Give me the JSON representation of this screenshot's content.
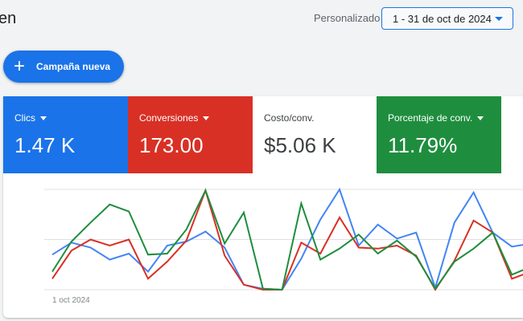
{
  "header": {
    "title": "en",
    "custom_label": "Personalizado",
    "date_range": "1 - 31 de oct de 2024"
  },
  "new_campaign": {
    "icon": "plus-icon",
    "label": "Campaña nueva"
  },
  "metrics": [
    {
      "label": "Clics",
      "value": "1.47 K",
      "color": "#1a73e8",
      "dropdown": true
    },
    {
      "label": "Conversiones",
      "value": "173.00",
      "color": "#d93025",
      "dropdown": true
    },
    {
      "label": "Costo/conv.",
      "value": "$5.06 K",
      "color": "#ffffff",
      "dropdown": false
    },
    {
      "label": "Porcentaje de conv.",
      "value": "11.79%",
      "color": "#1e8e3e",
      "dropdown": true
    }
  ],
  "chart_data": {
    "type": "line",
    "x_start_label": "1 oct 2024",
    "ylim": [
      0,
      100
    ],
    "grid": true,
    "series": [
      {
        "name": "Clics",
        "color": "#4285f4",
        "values": [
          35,
          47,
          42,
          30,
          36,
          18,
          44,
          48,
          58,
          42,
          5,
          1,
          0,
          31,
          70,
          100,
          44,
          65,
          51,
          57,
          2,
          67,
          97,
          57,
          43,
          46
        ]
      },
      {
        "name": "Conversiones",
        "color": "#d93025",
        "values": [
          11,
          39,
          50,
          44,
          50,
          11,
          28,
          49,
          99,
          34,
          5,
          0,
          0,
          47,
          36,
          72,
          42,
          41,
          44,
          34,
          0,
          29,
          69,
          57,
          11,
          18
        ]
      },
      {
        "name": "Porcentaje de conv.",
        "color": "#1e8e3e",
        "values": [
          18,
          48,
          67,
          85,
          78,
          35,
          36,
          60,
          99,
          46,
          77,
          1,
          0,
          86,
          30,
          41,
          55,
          36,
          49,
          33,
          1,
          28,
          41,
          57,
          15,
          23
        ]
      }
    ]
  }
}
